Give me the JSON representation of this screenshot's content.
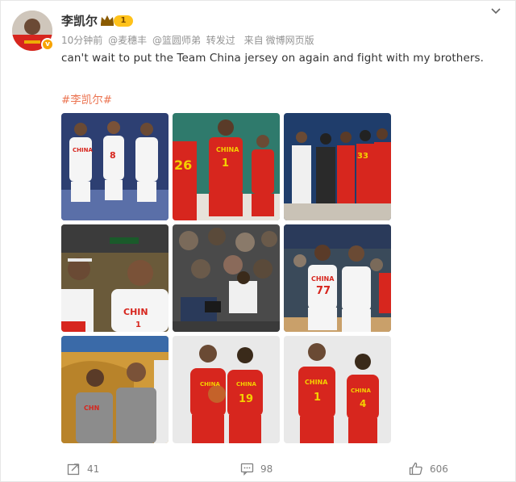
{
  "user": {
    "name": "李凯尔",
    "level": "1",
    "verified_mark": "v"
  },
  "meta": {
    "time": "10分钟前",
    "mention1": "@麦穗丰",
    "mention2": "@篮圆师弟",
    "forwarded": "转发过",
    "source_prefix": "来自",
    "source": "微博网页版"
  },
  "post": {
    "text": "can't wait to put the Team China jersey on again and fight with my brothers.",
    "hashtag": "#李凯尔#"
  },
  "photos": [
    {
      "jersey_text": "CHINA",
      "numbers": [
        "8"
      ]
    },
    {
      "jersey_text": "CHINA",
      "numbers": [
        "26",
        "1"
      ]
    },
    {
      "jersey_text": "",
      "numbers": [
        "33"
      ]
    },
    {
      "jersey_text": "CHIN",
      "numbers": [
        "1"
      ]
    },
    {
      "jersey_text": "",
      "numbers": []
    },
    {
      "jersey_text": "CHINA",
      "numbers": [
        "77"
      ]
    },
    {
      "jersey_text": "CHN",
      "numbers": []
    },
    {
      "jersey_text": "CHINA",
      "numbers": [
        "19"
      ]
    },
    {
      "jersey_text": "CHINA",
      "numbers": [
        "1",
        "4"
      ]
    }
  ],
  "actions": {
    "share_count": "41",
    "comment_count": "98",
    "like_count": "606"
  },
  "icons": {
    "crown": "crown-icon",
    "collapse": "chevron-down-icon",
    "share": "share-icon",
    "comment": "comment-icon",
    "like": "thumbs-up-icon"
  },
  "colors": {
    "hashtag": "#eb7350",
    "meta_gray": "#939393",
    "level_badge": "#ffc21a",
    "jersey_red": "#d7261e"
  }
}
